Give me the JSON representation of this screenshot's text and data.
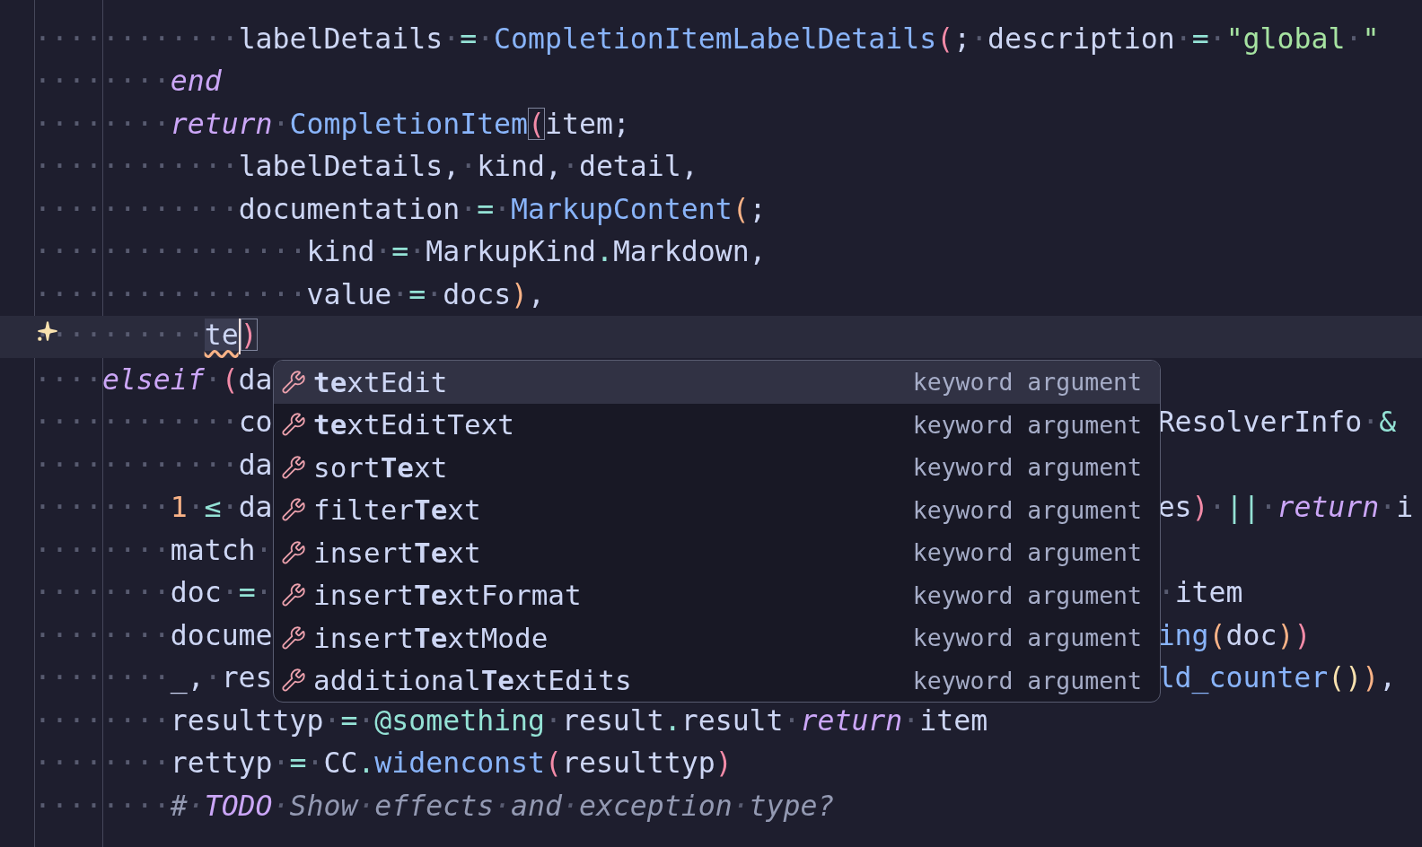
{
  "editor": {
    "lines": [
      {
        "current": false,
        "left": [
          {
            "kind": "plain",
            "text": "············labelDetails·"
          },
          {
            "kind": "op",
            "text": "="
          },
          {
            "kind": "plain",
            "text": "·"
          },
          {
            "kind": "func",
            "text": "CompletionItemLabelDetails"
          },
          {
            "kind": "paren1",
            "text": "("
          },
          {
            "kind": "plain",
            "text": ";·description·"
          },
          {
            "kind": "op",
            "text": "="
          },
          {
            "kind": "plain",
            "text": "·"
          },
          {
            "kind": "string",
            "text": "\"global·\""
          }
        ]
      },
      {
        "current": false,
        "left": [
          {
            "kind": "plain",
            "text": "········"
          },
          {
            "kind": "keyword",
            "text": "end"
          }
        ]
      },
      {
        "current": false,
        "left": [
          {
            "kind": "plain",
            "text": "········"
          },
          {
            "kind": "keyword",
            "text": "return"
          },
          {
            "kind": "plain",
            "text": "·"
          },
          {
            "kind": "func",
            "text": "CompletionItem"
          },
          {
            "kind": "match",
            "text": "("
          },
          {
            "kind": "plain",
            "text": "item;"
          }
        ]
      },
      {
        "current": false,
        "left": [
          {
            "kind": "plain",
            "text": "············labelDetails,·kind,·detail,"
          }
        ]
      },
      {
        "current": false,
        "left": [
          {
            "kind": "plain",
            "text": "············documentation·"
          },
          {
            "kind": "op",
            "text": "="
          },
          {
            "kind": "plain",
            "text": "·"
          },
          {
            "kind": "func",
            "text": "MarkupContent"
          },
          {
            "kind": "paren2",
            "text": "("
          },
          {
            "kind": "plain",
            "text": ";"
          }
        ]
      },
      {
        "current": false,
        "left": [
          {
            "kind": "plain",
            "text": "················kind·"
          },
          {
            "kind": "op",
            "text": "="
          },
          {
            "kind": "plain",
            "text": "·MarkupKind"
          },
          {
            "kind": "op",
            "text": "."
          },
          {
            "kind": "plain",
            "text": "Markdown,"
          }
        ]
      },
      {
        "current": false,
        "left": [
          {
            "kind": "plain",
            "text": "················value·"
          },
          {
            "kind": "op",
            "text": "="
          },
          {
            "kind": "plain",
            "text": "·docs"
          },
          {
            "kind": "paren2",
            "text": ")"
          },
          {
            "kind": "plain",
            "text": ","
          }
        ]
      },
      {
        "current": true,
        "left": [
          {
            "kind": "plain",
            "text": "··········"
          },
          {
            "kind": "typed",
            "text": "te"
          },
          {
            "kind": "match",
            "text": ")"
          }
        ]
      },
      {
        "current": false,
        "left": [
          {
            "kind": "plain",
            "text": "····"
          },
          {
            "kind": "keyword",
            "text": "elseif"
          },
          {
            "kind": "plain",
            "text": "·"
          },
          {
            "kind": "paren1",
            "text": "("
          },
          {
            "kind": "plain",
            "text": "da"
          }
        ]
      },
      {
        "current": false,
        "left": [
          {
            "kind": "plain",
            "text": "············co"
          }
        ],
        "right": [
          {
            "kind": "plain",
            "text": "ResolverInfo·"
          },
          {
            "kind": "op",
            "text": "&"
          }
        ]
      },
      {
        "current": false,
        "left": [
          {
            "kind": "plain",
            "text": "············da"
          }
        ]
      },
      {
        "current": false,
        "left": [
          {
            "kind": "plain",
            "text": "········"
          },
          {
            "kind": "number",
            "text": "1"
          },
          {
            "kind": "plain",
            "text": "·"
          },
          {
            "kind": "op",
            "text": "≤"
          },
          {
            "kind": "plain",
            "text": "·da"
          }
        ],
        "right": [
          {
            "kind": "plain",
            "text": "es"
          },
          {
            "kind": "paren1",
            "text": ")"
          },
          {
            "kind": "plain",
            "text": "·"
          },
          {
            "kind": "op",
            "text": "||"
          },
          {
            "kind": "plain",
            "text": "·"
          },
          {
            "kind": "keyword",
            "text": "return"
          },
          {
            "kind": "plain",
            "text": "·i"
          }
        ]
      },
      {
        "current": false,
        "left": [
          {
            "kind": "plain",
            "text": "········match·"
          }
        ]
      },
      {
        "current": false,
        "left": [
          {
            "kind": "plain",
            "text": "········doc·"
          },
          {
            "kind": "op",
            "text": "="
          },
          {
            "kind": "plain",
            "text": "·"
          }
        ],
        "right": [
          {
            "kind": "plain",
            "text": "·item"
          }
        ]
      },
      {
        "current": false,
        "left": [
          {
            "kind": "plain",
            "text": "········docume"
          }
        ],
        "right": [
          {
            "kind": "func",
            "text": "ing"
          },
          {
            "kind": "paren2",
            "text": "("
          },
          {
            "kind": "plain",
            "text": "doc"
          },
          {
            "kind": "paren2",
            "text": ")"
          },
          {
            "kind": "paren1",
            "text": ")"
          }
        ]
      },
      {
        "current": false,
        "left": [
          {
            "kind": "plain",
            "text": "········_,·res"
          }
        ],
        "right": [
          {
            "kind": "func",
            "text": "ld_counter"
          },
          {
            "kind": "paren3",
            "text": "()"
          },
          {
            "kind": "paren2",
            "text": ")"
          },
          {
            "kind": "plain",
            "text": ","
          }
        ]
      },
      {
        "current": false,
        "left": [
          {
            "kind": "plain",
            "text": "········resulttyp·"
          },
          {
            "kind": "op",
            "text": "="
          },
          {
            "kind": "plain",
            "text": "·"
          },
          {
            "kind": "macro",
            "text": "@something"
          },
          {
            "kind": "plain",
            "text": "·result"
          },
          {
            "kind": "op",
            "text": "."
          },
          {
            "kind": "plain",
            "text": "result·"
          },
          {
            "kind": "keyword",
            "text": "return"
          },
          {
            "kind": "plain",
            "text": "·item"
          }
        ]
      },
      {
        "current": false,
        "left": [
          {
            "kind": "plain",
            "text": "········rettyp·"
          },
          {
            "kind": "op",
            "text": "="
          },
          {
            "kind": "plain",
            "text": "·CC"
          },
          {
            "kind": "op",
            "text": "."
          },
          {
            "kind": "func",
            "text": "widenconst"
          },
          {
            "kind": "paren1",
            "text": "("
          },
          {
            "kind": "plain",
            "text": "resulttyp"
          },
          {
            "kind": "paren1",
            "text": ")"
          }
        ]
      },
      {
        "current": false,
        "left": [
          {
            "kind": "plain",
            "text": "········"
          },
          {
            "kind": "comment",
            "text": "#·"
          },
          {
            "kind": "todo",
            "text": "TODO"
          },
          {
            "kind": "comment",
            "text": "·Show·effects·and·exception·type?"
          }
        ]
      }
    ]
  },
  "completion": {
    "items": [
      {
        "label": "**te**xtEdit",
        "detail": "keyword argument",
        "selected": true
      },
      {
        "label": "**te**xtEditText",
        "detail": "keyword argument",
        "selected": false
      },
      {
        "label": "sort**Te**xt",
        "detail": "keyword argument",
        "selected": false
      },
      {
        "label": "filter**Te**xt",
        "detail": "keyword argument",
        "selected": false
      },
      {
        "label": "insert**Te**xt",
        "detail": "keyword argument",
        "selected": false
      },
      {
        "label": "insert**Te**xtFormat",
        "detail": "keyword argument",
        "selected": false
      },
      {
        "label": "insert**Te**xtMode",
        "detail": "keyword argument",
        "selected": false
      },
      {
        "label": "additional**Te**xtEdits",
        "detail": "keyword argument",
        "selected": false
      }
    ]
  }
}
